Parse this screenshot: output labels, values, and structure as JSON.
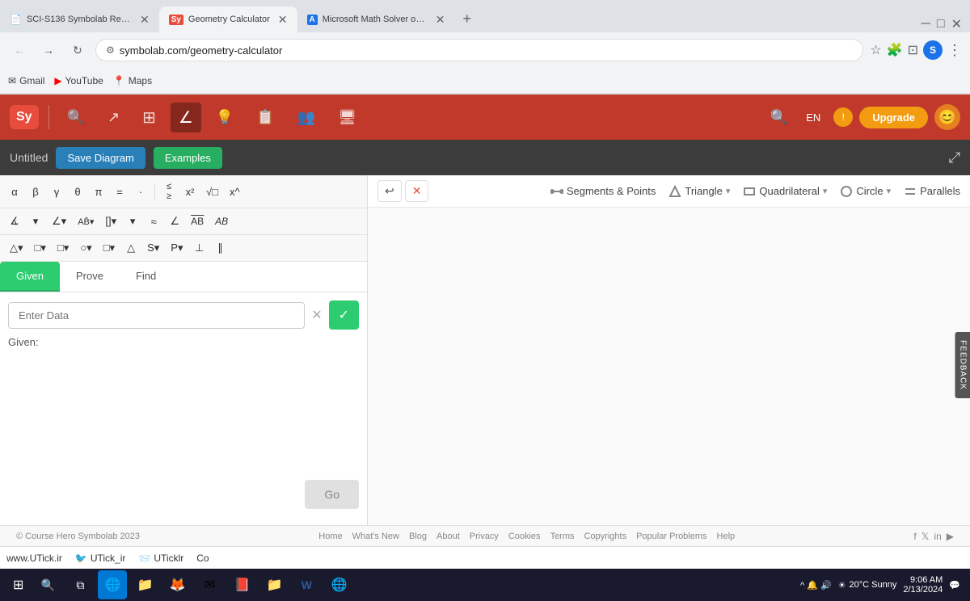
{
  "browser": {
    "tabs": [
      {
        "id": "tab1",
        "title": "SCI-S136 Symbolab Review - G...",
        "favicon": "📄",
        "active": false
      },
      {
        "id": "tab2",
        "title": "Geometry Calculator",
        "favicon": "Sy",
        "active": true
      },
      {
        "id": "tab3",
        "title": "Microsoft Math Solver on the A...",
        "favicon": "A",
        "active": false
      }
    ],
    "new_tab_label": "+",
    "address": "symbolab.com/geometry-calculator",
    "address_icon": "⚙",
    "back_btn": "←",
    "forward_btn": "→",
    "refresh_btn": "↻",
    "star_icon": "☆",
    "extensions_icon": "🧩",
    "layout_icon": "⊡",
    "profile_label": "S",
    "more_icon": "⋮"
  },
  "bookmarks": [
    {
      "label": "Gmail",
      "icon": "✉"
    },
    {
      "label": "YouTube",
      "icon": "▶"
    },
    {
      "label": "Maps",
      "icon": "📍"
    }
  ],
  "toolbar": {
    "logo": "Sy",
    "tools": [
      {
        "name": "search",
        "icon": "🔍"
      },
      {
        "name": "graph",
        "icon": "↗"
      },
      {
        "name": "grid",
        "icon": "⊞"
      },
      {
        "name": "geometry",
        "icon": "∠",
        "active": true
      },
      {
        "name": "lightbulb",
        "icon": "💡"
      },
      {
        "name": "notes",
        "icon": "📋"
      },
      {
        "name": "users",
        "icon": "👥"
      },
      {
        "name": "monitor",
        "icon": "🖥"
      }
    ],
    "search_icon": "🔍",
    "lang": "EN",
    "notif_icon": "!",
    "upgrade_label": "Upgrade",
    "avatar_icon": "😊"
  },
  "diagram_bar": {
    "title": "Untitled",
    "save_label": "Save Diagram",
    "examples_label": "Examples",
    "share_icon": "⤢"
  },
  "symbol_rows": {
    "row1": [
      "α",
      "β",
      "γ",
      "θ",
      "π",
      "=",
      "·",
      "≤",
      "x²",
      "√□",
      "x^"
    ],
    "row2": [
      "∡",
      "∠",
      "AB̄",
      "AB"
    ],
    "row3": [
      "△",
      "□",
      "○",
      "S▾",
      "P▾",
      "⊥",
      "∥"
    ]
  },
  "canvas_toolbar": {
    "undo_icon": "↩",
    "close_icon": "✕",
    "segments_points_label": "Segments & Points",
    "triangle_label": "Triangle",
    "quadrilateral_label": "Quadrilateral",
    "circle_label": "Circle",
    "parallels_label": "Parallels",
    "dropdown_icon": "▾"
  },
  "tabs": {
    "given_label": "Given",
    "prove_label": "Prove",
    "find_label": "Find"
  },
  "input": {
    "placeholder": "Enter Data",
    "clear_icon": "✕",
    "check_icon": "✓",
    "given_prefix": "Given:"
  },
  "go_btn": "Go",
  "footer": {
    "copyright": "© Course Hero Symbolab 2023",
    "links": [
      "Home",
      "What's New",
      "Blog",
      "About",
      "Privacy",
      "Cookies",
      "Terms",
      "Copyrights",
      "Popular Problems",
      "Help"
    ],
    "social": [
      "f",
      "𝕏",
      "in",
      "▶"
    ]
  },
  "feedback_label": "FEEDBACK",
  "taskbar": {
    "start_icon": "⊞",
    "items": [
      "🌐",
      "📁",
      "🦊",
      "✉",
      "📕",
      "📁",
      "W",
      "🌐"
    ],
    "tray": {
      "weather": "20°C Sunny",
      "time": "9:06 AM",
      "date": "2/13/2024"
    }
  },
  "utick_bar": {
    "items": [
      {
        "label": "www.UTick.ir"
      },
      {
        "label": "UTick_ir",
        "icon": "🐦"
      },
      {
        "label": "UTicklr",
        "icon": "📨"
      },
      {
        "label": "Co"
      }
    ]
  }
}
